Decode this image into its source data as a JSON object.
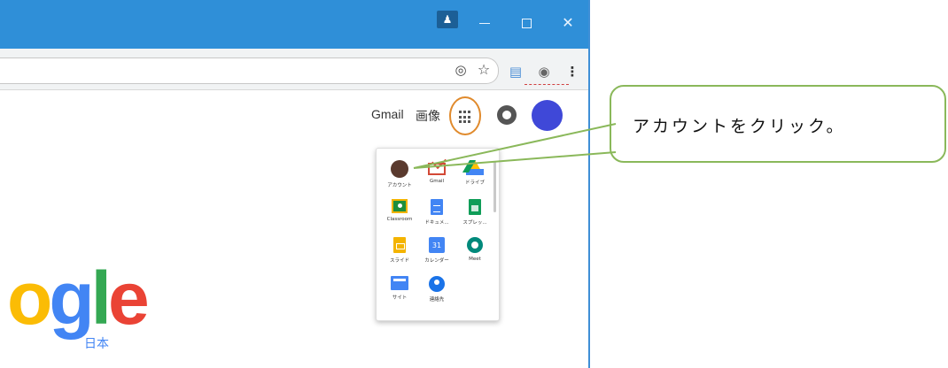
{
  "header": {
    "gmail_label": "Gmail",
    "images_label": "画像"
  },
  "apps_panel": {
    "items": [
      {
        "label": "アカウント",
        "icon": "account-icon"
      },
      {
        "label": "Gmail",
        "icon": "gmail-icon"
      },
      {
        "label": "ドライブ",
        "icon": "drive-icon"
      },
      {
        "label": "Classroom",
        "icon": "classroom-icon"
      },
      {
        "label": "ドキュメ...",
        "icon": "docs-icon"
      },
      {
        "label": "スプレッ...",
        "icon": "sheets-icon"
      },
      {
        "label": "スライド",
        "icon": "slides-icon"
      },
      {
        "label": "カレンダー",
        "icon": "calendar-icon"
      },
      {
        "label": "Meet",
        "icon": "meet-icon"
      },
      {
        "label": "サイト",
        "icon": "sites-icon"
      },
      {
        "label": "連絡先",
        "icon": "contacts-icon"
      }
    ],
    "calendar_day": "31"
  },
  "logo": {
    "text": "ogle",
    "region": "日本"
  },
  "callout": {
    "text": "アカウントをクリック。"
  },
  "colors": {
    "titlebar": "#2f8fd8",
    "apps_highlight": "#e08a2c",
    "callout_border": "#8ab85a",
    "avatar": "#3f48d8"
  }
}
